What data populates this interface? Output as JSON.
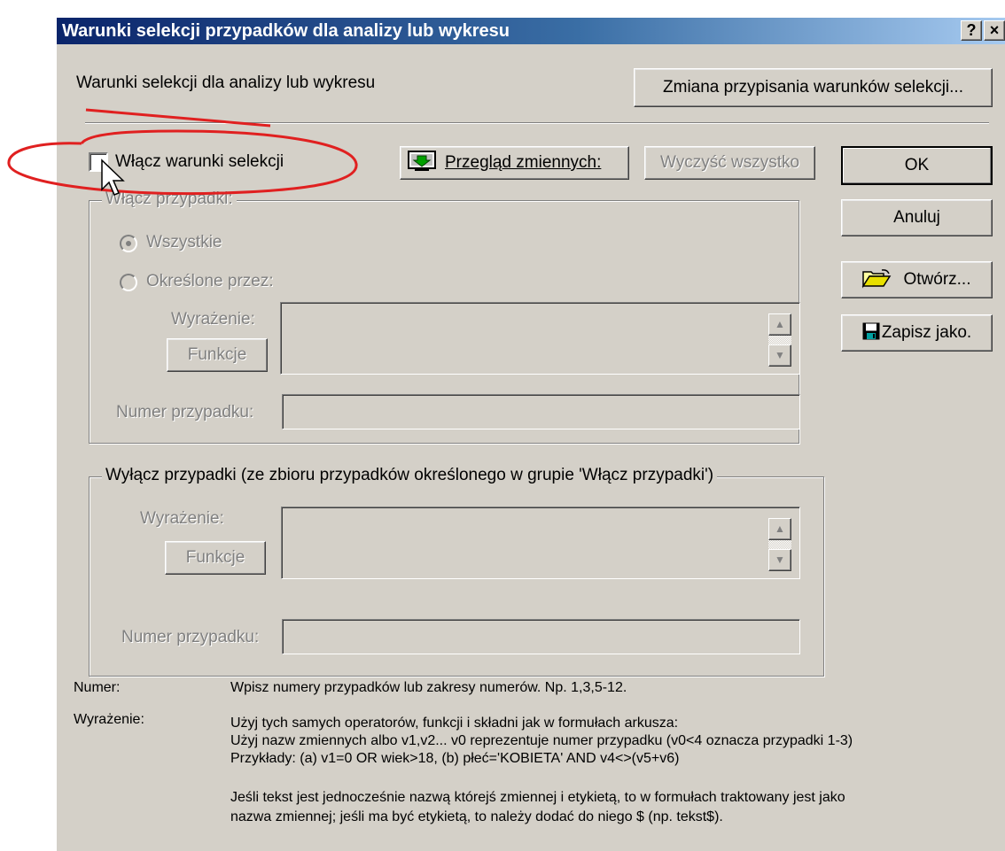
{
  "window": {
    "title": "Warunki selekcji przypadków dla analizy lub wykresu",
    "help_button": "?",
    "close_button": "×"
  },
  "header": {
    "label": "Warunki selekcji dla analizy lub wykresu",
    "change_assignment_button": "Zmiana przypisania warunków selekcji..."
  },
  "enable": {
    "checkbox_label": "Włącz warunki selekcji",
    "checked": false
  },
  "toolbar": {
    "browse_variables_button": "Przegląd zmiennych:",
    "clear_all_button": "Wyczyść wszystko"
  },
  "side_buttons": {
    "ok": "OK",
    "cancel": "Anuluj",
    "open": "Otwórz...",
    "save_as": "Zapisz jako."
  },
  "include_group": {
    "title": "Włącz przypadki:",
    "radio_all": "Wszystkie",
    "radio_specified": "Określone przez:",
    "selected": "Wszystkie",
    "expression_label": "Wyrażenie:",
    "functions_button": "Funkcje",
    "case_number_label": "Numer przypadku:",
    "expression_value": "",
    "case_number_value": ""
  },
  "exclude_group": {
    "title": "Wyłącz przypadki (ze zbioru przypadków określonego w grupie 'Włącz przypadki')",
    "expression_label": "Wyrażenie:",
    "functions_button": "Funkcje",
    "case_number_label": "Numer przypadku:",
    "expression_value": "",
    "case_number_value": ""
  },
  "help": {
    "number_label": "Numer:",
    "number_text": "Wpisz numery przypadków lub zakresy numerów. Np.  1,3,5-12.",
    "expression_label": "Wyrażenie:",
    "expression_lines": [
      "Użyj tych samych operatorów, funkcji i składni jak w formułach arkusza:",
      "Użyj nazw zmiennych albo v1,v2...   v0 reprezentuje numer przypadku (v0<4 oznacza przypadki 1-3)",
      "Przykłady: (a) v1=0 OR wiek>18,   (b) płeć='KOBIETA' AND v4<>(v5+v6)"
    ],
    "note_lines": [
      "Jeśli tekst jest jednocześnie nazwą którejś zmiennej i etykietą, to w formułach traktowany jest jako",
      "nazwa zmiennej; jeśli ma być etykietą, to należy dodać do niego $ (np. tekst$)."
    ]
  },
  "colors": {
    "face": "#d4d0c8",
    "title_start": "#0a246a",
    "title_end": "#a6caf0",
    "disabled_text": "#808080",
    "annotation": "#e02020"
  }
}
